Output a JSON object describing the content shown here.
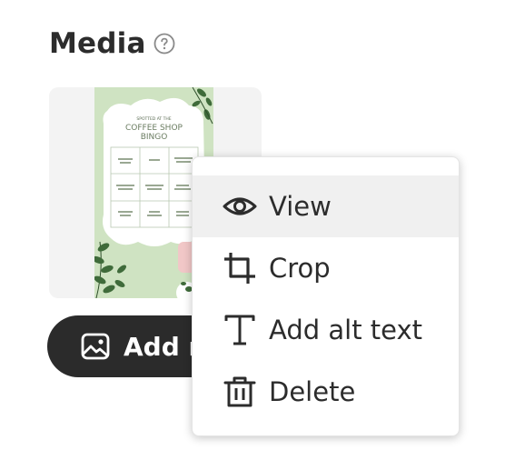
{
  "media": {
    "title": "Media",
    "help_icon": "question-circle-icon"
  },
  "thumbnail": {
    "caption_small": "SPOTTED AT THE",
    "caption_title_line1": "COFFEE SHOP",
    "caption_title_line2": "BINGO",
    "colors": {
      "background": "#cfe3c2",
      "cloud": "#ffffff",
      "leaf": "#3f6b3a",
      "pink": "#f1c7c7"
    }
  },
  "add_media_button": {
    "label": "Add m",
    "icon": "image-icon"
  },
  "context_menu": {
    "items": [
      {
        "label": "View",
        "icon": "eye-icon",
        "highlighted": true
      },
      {
        "label": "Crop",
        "icon": "crop-icon",
        "highlighted": false
      },
      {
        "label": "Add alt text",
        "icon": "text-t-icon",
        "highlighted": false
      },
      {
        "label": "Delete",
        "icon": "trash-icon",
        "highlighted": false
      }
    ]
  },
  "colors": {
    "text": "#2c2c2c",
    "button_bg": "#2b2b2b",
    "menu_highlight": "#f0f0f0"
  }
}
